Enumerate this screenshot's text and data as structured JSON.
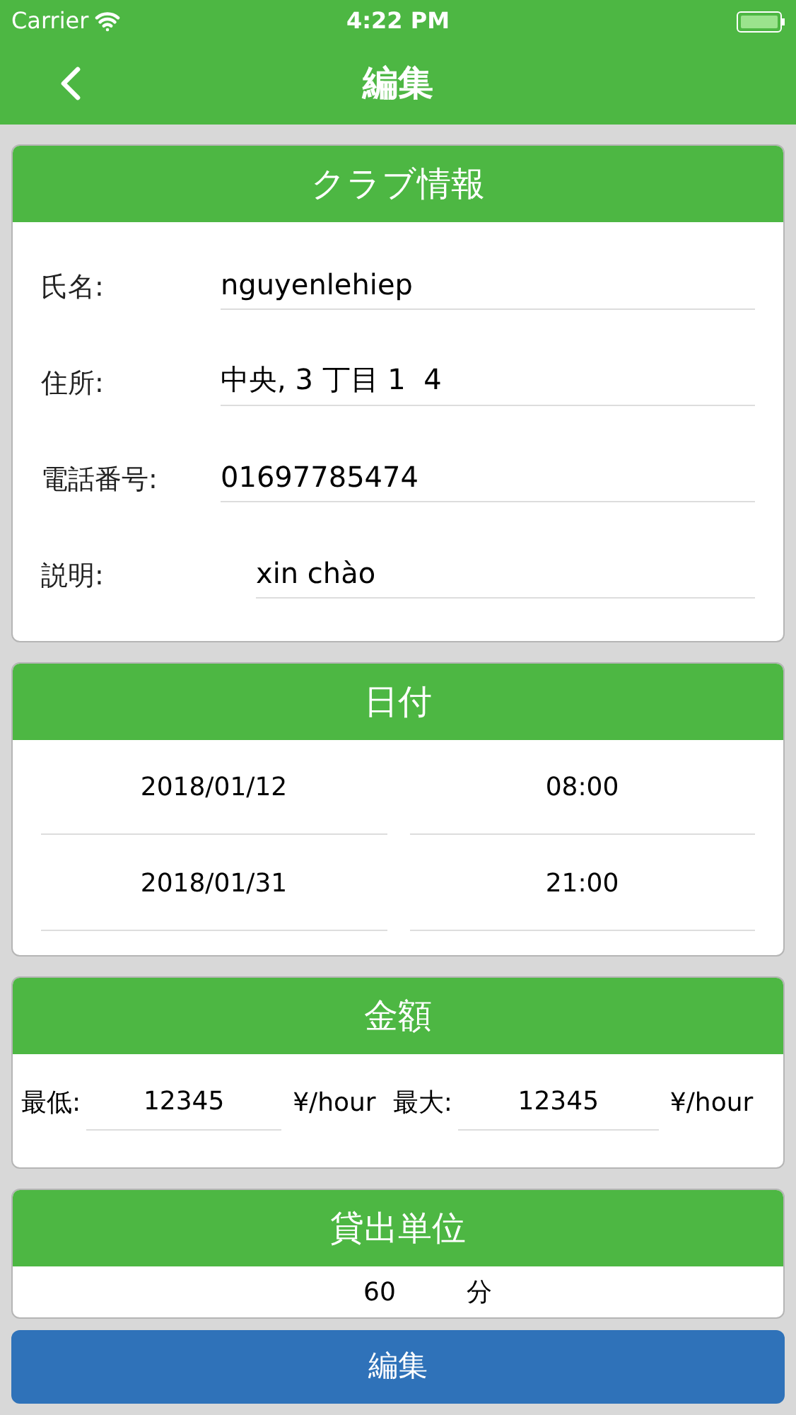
{
  "status_bar": {
    "carrier": "Carrier",
    "time": "4:22 PM"
  },
  "nav": {
    "title": "編集"
  },
  "club_info": {
    "title": "クラブ情報",
    "fields": [
      {
        "label": "氏名:",
        "value": "nguyenlehiep",
        "indented": false
      },
      {
        "label": "住所:",
        "value": "中央, 3 丁目 1  4",
        "indented": false
      },
      {
        "label": "電話番号:",
        "value": "01697785474",
        "indented": false
      },
      {
        "label": "説明:",
        "value": "xin chào",
        "indented": true
      }
    ]
  },
  "dates": {
    "title": "日付",
    "rows": [
      {
        "date": "2018/01/12",
        "time": "08:00"
      },
      {
        "date": "2018/01/31",
        "time": "21:00"
      }
    ]
  },
  "amount": {
    "title": "金額",
    "min_label": "最低:",
    "min_value": "12345",
    "min_unit": "¥/hour",
    "max_label": "最大:",
    "max_value": "12345",
    "max_unit": "¥/hour"
  },
  "rental_unit": {
    "title": "貸出単位",
    "value": "60",
    "unit": "分"
  },
  "edit_button": {
    "label": "編集"
  }
}
